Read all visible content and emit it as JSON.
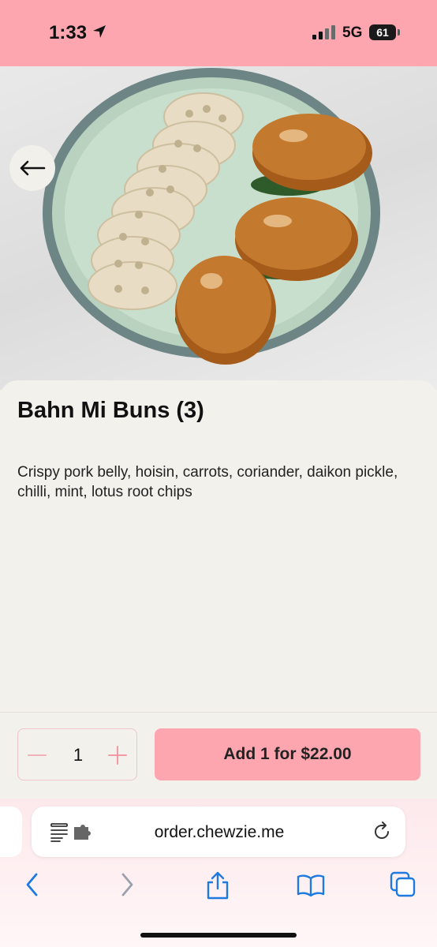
{
  "status_bar": {
    "time": "1:33",
    "network": "5G",
    "battery": "61"
  },
  "hero": {
    "image_desc": "Plate with lotus root chips and three glazed bahn mi buns"
  },
  "item": {
    "title": "Bahn Mi Buns (3)",
    "description": "Crispy pork belly, hoisin, carrots, coriander, daikon pickle, chilli, mint, lotus root chips"
  },
  "order": {
    "quantity": "1",
    "add_label": "Add 1 for $22.00"
  },
  "browser": {
    "url": "order.chewzie.me"
  },
  "colors": {
    "accent": "#fea6b0",
    "background": "#f2f1ec",
    "link_blue": "#1f7ae0"
  },
  "icons": [
    "location-arrow-icon",
    "signal-icon",
    "battery-icon",
    "back-arrow-icon",
    "minus-icon",
    "plus-icon",
    "reader-icon",
    "extension-icon",
    "reload-icon",
    "back-nav-icon",
    "forward-nav-icon",
    "share-icon",
    "bookmarks-icon",
    "tabs-icon"
  ]
}
